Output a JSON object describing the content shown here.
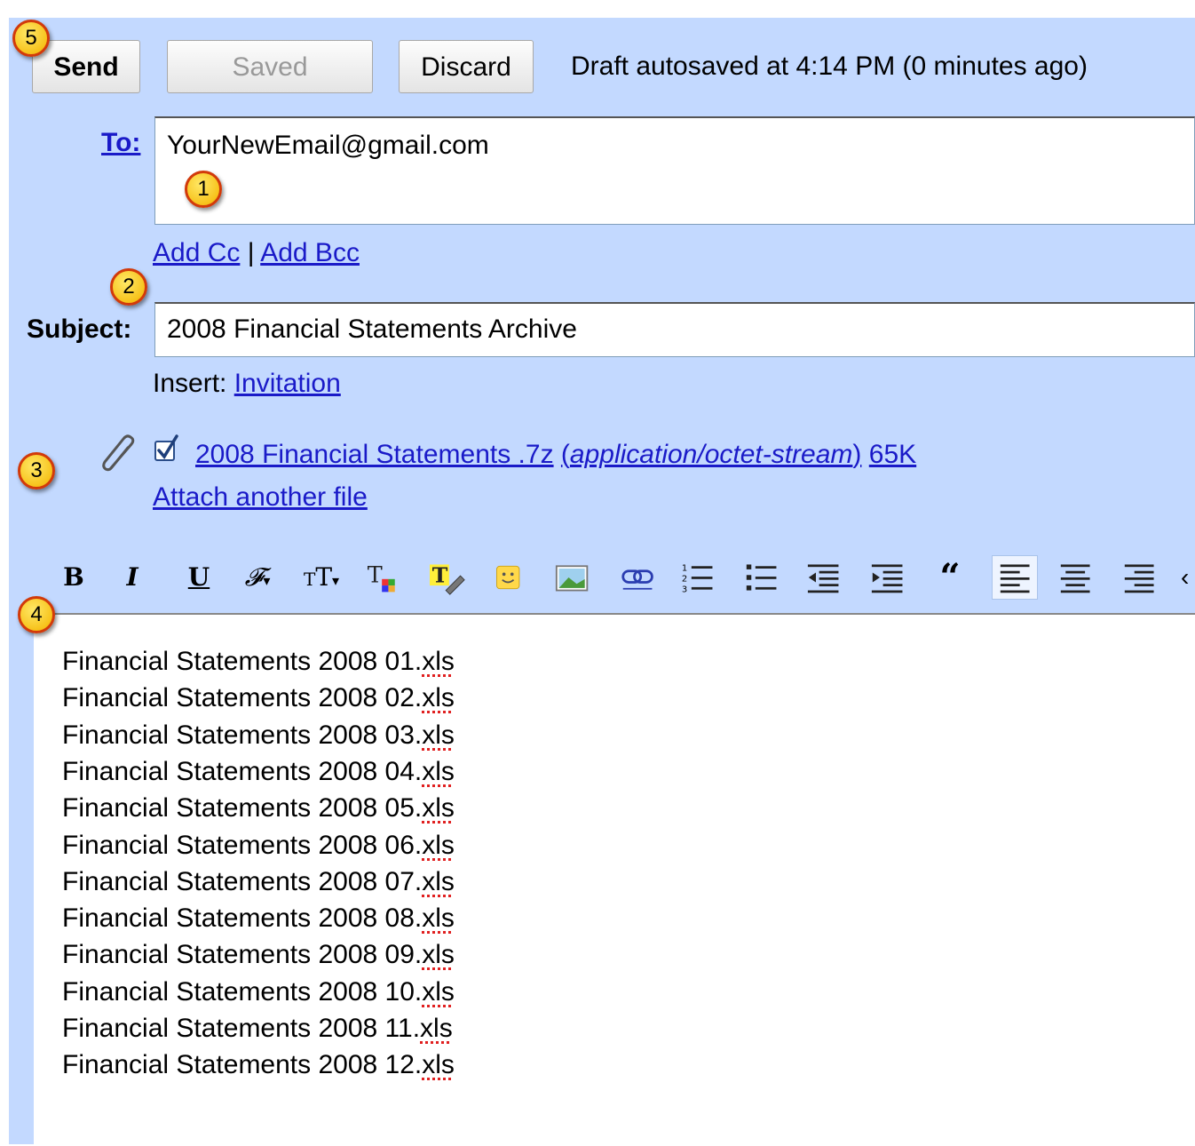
{
  "toolbar": {
    "send_label": "Send",
    "saved_label": "Saved",
    "discard_label": "Discard",
    "status": "Draft autosaved at 4:14 PM (0 minutes ago)"
  },
  "to": {
    "label": "To:",
    "value": "YourNewEmail@gmail.com"
  },
  "cc_links": {
    "add_cc": "Add Cc",
    "separator": "|",
    "add_bcc": "Add Bcc"
  },
  "subject": {
    "label": "Subject:",
    "value": "2008 Financial Statements Archive"
  },
  "insert": {
    "label": "Insert:",
    "link": "Invitation"
  },
  "attachment": {
    "name": "2008 Financial Statements .7z",
    "type": "application/octet-stream",
    "size": "65K",
    "checked": true,
    "attach_another": "Attach another file"
  },
  "badges": [
    "1",
    "2",
    "3",
    "4",
    "5"
  ],
  "format_toolbar": [
    "bold-icon",
    "italic-icon",
    "underline-icon",
    "font-icon",
    "text-size-icon",
    "text-color-icon",
    "highlight-icon",
    "emoji-icon",
    "image-icon",
    "link-icon",
    "numbered-list-icon",
    "bulleted-list-icon",
    "indent-less-icon",
    "indent-more-icon",
    "quote-icon",
    "align-left-icon",
    "align-center-icon",
    "align-right-icon"
  ],
  "body_lines": [
    {
      "prefix": "Financial Statements 2008 01.",
      "ext": "xls"
    },
    {
      "prefix": "Financial Statements 2008 02.",
      "ext": "xls"
    },
    {
      "prefix": "Financial Statements 2008 03.",
      "ext": "xls"
    },
    {
      "prefix": "Financial Statements 2008 04.",
      "ext": "xls"
    },
    {
      "prefix": "Financial Statements 2008 05.",
      "ext": "xls"
    },
    {
      "prefix": "Financial Statements 2008 06.",
      "ext": "xls"
    },
    {
      "prefix": "Financial Statements 2008 07.",
      "ext": "xls"
    },
    {
      "prefix": "Financial Statements 2008 08.",
      "ext": "xls"
    },
    {
      "prefix": "Financial Statements 2008 09.",
      "ext": "xls"
    },
    {
      "prefix": "Financial Statements 2008 10.",
      "ext": "xls"
    },
    {
      "prefix": "Financial Statements 2008 11.",
      "ext": "xls"
    },
    {
      "prefix": "Financial Statements 2008 12.",
      "ext": "xls"
    }
  ]
}
